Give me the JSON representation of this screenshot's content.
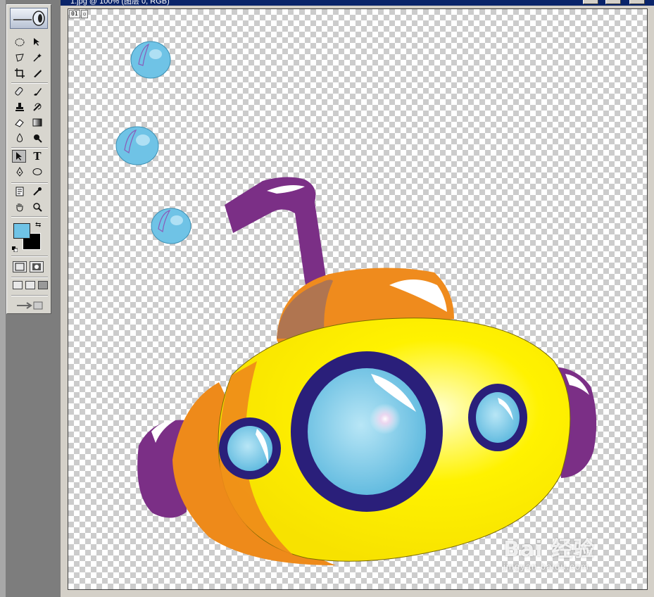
{
  "window": {
    "title": "1.jpg @ 100% (图层 0, RGB)"
  },
  "toolbox": {
    "foreground_color": "#6fc3e6",
    "background_color": "#000000",
    "tools": [
      "marquee-icon",
      "move-icon",
      "lasso-icon",
      "magic-wand-icon",
      "crop-icon",
      "slice-icon",
      "healing-brush-icon",
      "brush-icon",
      "clone-stamp-icon",
      "history-brush-icon",
      "eraser-icon",
      "gradient-icon",
      "blur-icon",
      "dodge-icon",
      "path-select-icon",
      "type-icon",
      "pen-icon",
      "shape-icon",
      "notes-icon",
      "eyedropper-icon",
      "hand-icon",
      "zoom-icon"
    ],
    "type_tool_glyph": "T"
  },
  "canvas": {
    "layer_badge": [
      "01",
      "▫"
    ]
  },
  "artwork": {
    "subject": "cartoon yellow submarine on transparent layer",
    "colors": {
      "hull": "#fff200",
      "hull_shadow": "#ee8a1a",
      "porthole_rim": "#2a1f7a",
      "porthole_glass": "#72c5e6",
      "periscope": "#7b2f86",
      "tower": "#f08a1e",
      "bubble": "#6fc3e6"
    }
  },
  "watermark": {
    "brand": "Bai 经验",
    "url": "jingyan.baidu.com"
  }
}
